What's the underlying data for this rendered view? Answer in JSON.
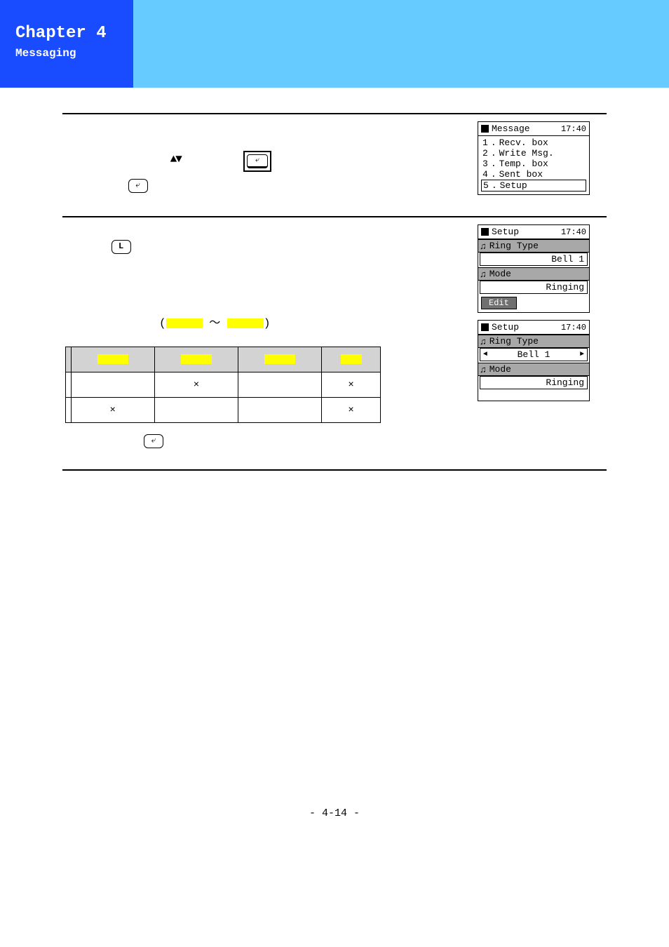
{
  "header": {
    "chapter": "Chapter 4",
    "subtitle": "Messaging"
  },
  "section1": {
    "updown": "▲▼",
    "screen": {
      "title": "Message",
      "time": "17:40",
      "items": [
        {
          "no": "1",
          "label": "Recv. box"
        },
        {
          "no": "2",
          "label": "Write Msg."
        },
        {
          "no": "3",
          "label": "Temp. box"
        },
        {
          "no": "4",
          "label": "Sent box"
        },
        {
          "no": "5",
          "label": "Setup",
          "selected": true
        }
      ]
    }
  },
  "section2": {
    "tilde": "～",
    "screen_a": {
      "title": "Setup",
      "time": "17:40",
      "ring_type_label": "Ring Type",
      "ring_type_value": "Bell 1",
      "mode_label": "Mode",
      "mode_value": "Ringing",
      "edit_label": "Edit"
    },
    "screen_b": {
      "title": "Setup",
      "time": "17:40",
      "ring_type_label": "Ring Type",
      "ring_type_value": "Bell 1",
      "mode_label": "Mode",
      "mode_value": "Ringing"
    },
    "table": {
      "r1": {
        "c1": "",
        "c2": "×",
        "c3": "",
        "c4": "×"
      },
      "r2": {
        "c1": "×",
        "c2": "",
        "c3": "",
        "c4": "×"
      }
    }
  },
  "page": "- 4-14 -"
}
